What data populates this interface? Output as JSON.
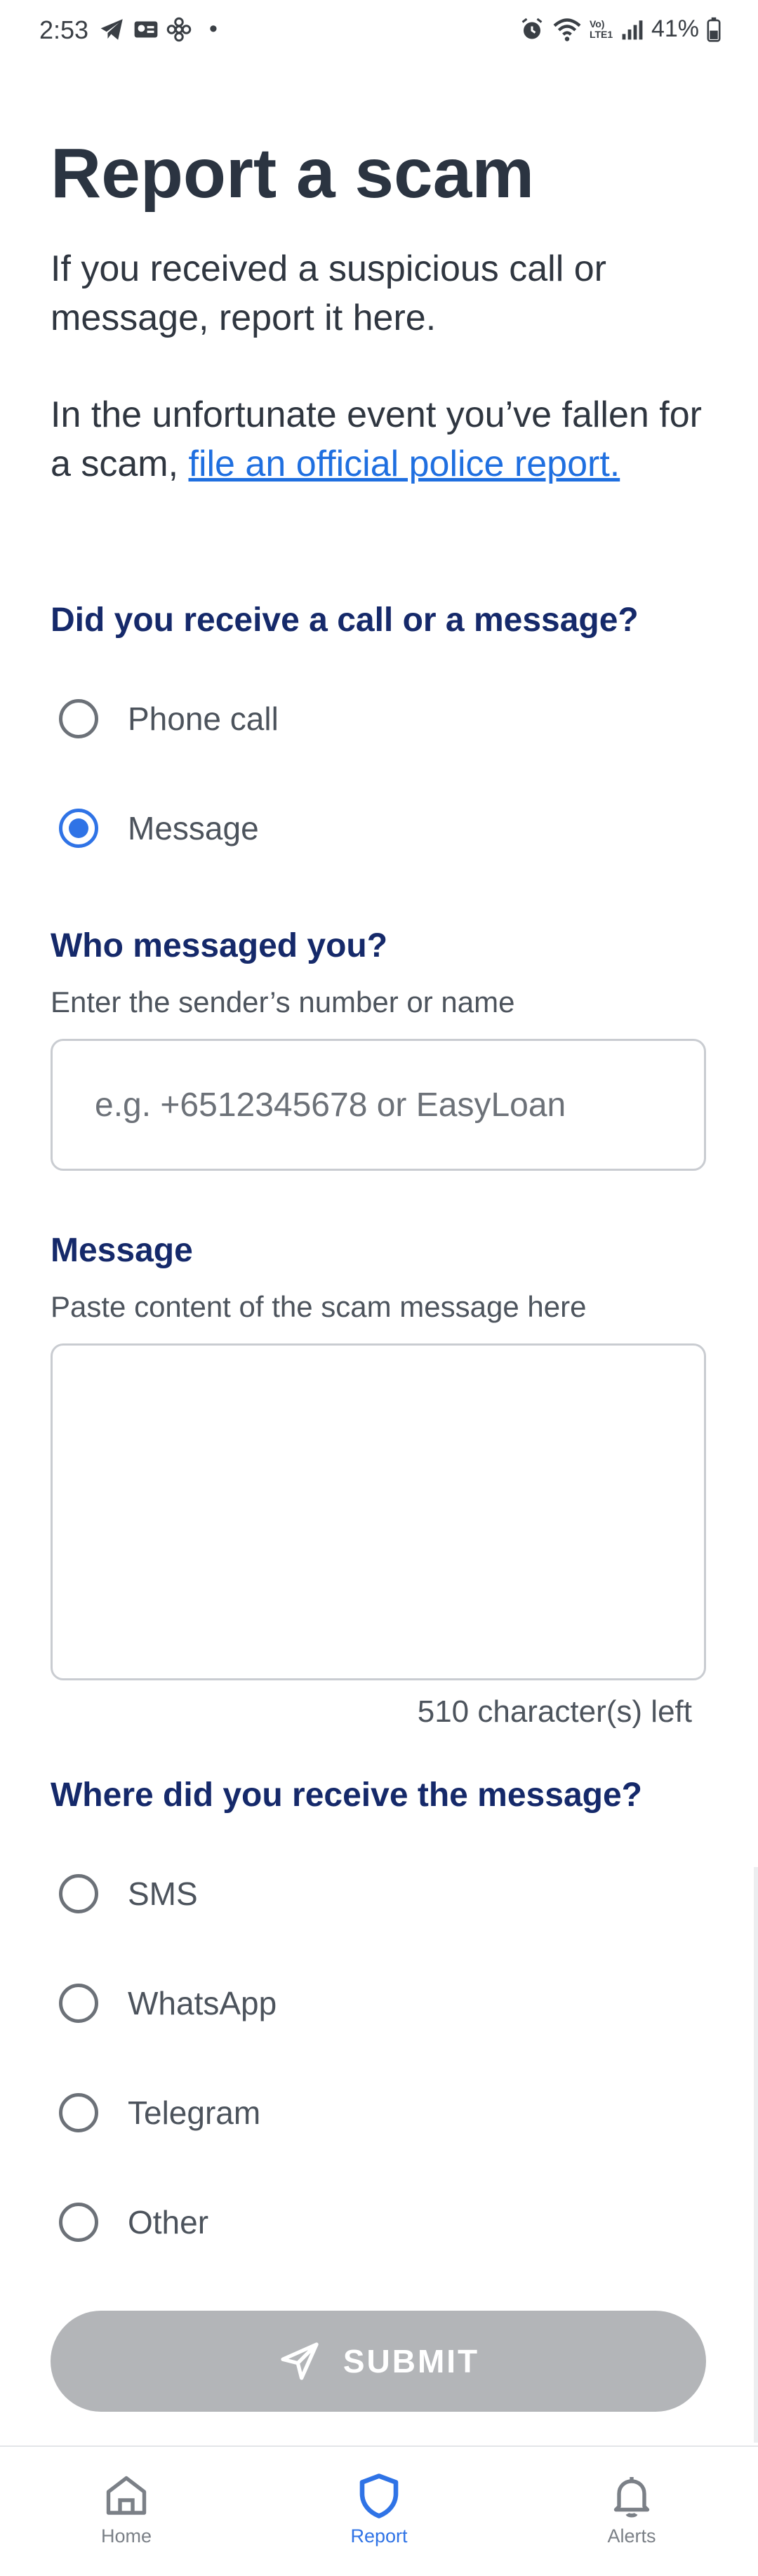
{
  "status_bar": {
    "time": "2:53",
    "battery": "41%",
    "dot": "•",
    "network_label": "Vo) LTE1"
  },
  "page": {
    "title": "Report a scam",
    "intro": "If you received a suspicious call or message, report it here.",
    "intro2_prefix": "In the unfortunate event you’ve fallen for a scam, ",
    "intro2_link": "file an official police report."
  },
  "contact_type": {
    "question": "Did you receive a call or a message?",
    "options": [
      "Phone call",
      "Message"
    ],
    "selected": "Message"
  },
  "sender": {
    "question": "Who messaged you?",
    "hint": "Enter the sender’s number or name",
    "placeholder": "e.g. +6512345678 or EasyLoan",
    "value": ""
  },
  "message": {
    "question": "Message",
    "hint": "Paste content of the scam message here",
    "value": "",
    "counter": "510 character(s) left"
  },
  "platform": {
    "question": "Where did you receive the message?",
    "options": [
      "SMS",
      "WhatsApp",
      "Telegram",
      "Other"
    ],
    "selected": ""
  },
  "submit": {
    "label": "SUBMIT",
    "icon": "send-icon",
    "color": "#b3b5b8"
  },
  "bottom_nav": {
    "items": [
      {
        "label": "Home",
        "icon": "home-icon"
      },
      {
        "label": "Report",
        "icon": "shield-icon"
      },
      {
        "label": "Alerts",
        "icon": "bell-icon"
      }
    ],
    "active": "Report"
  },
  "colors": {
    "accent": "#2f73e6",
    "heading": "#15296a",
    "link": "#1f6fe0"
  }
}
